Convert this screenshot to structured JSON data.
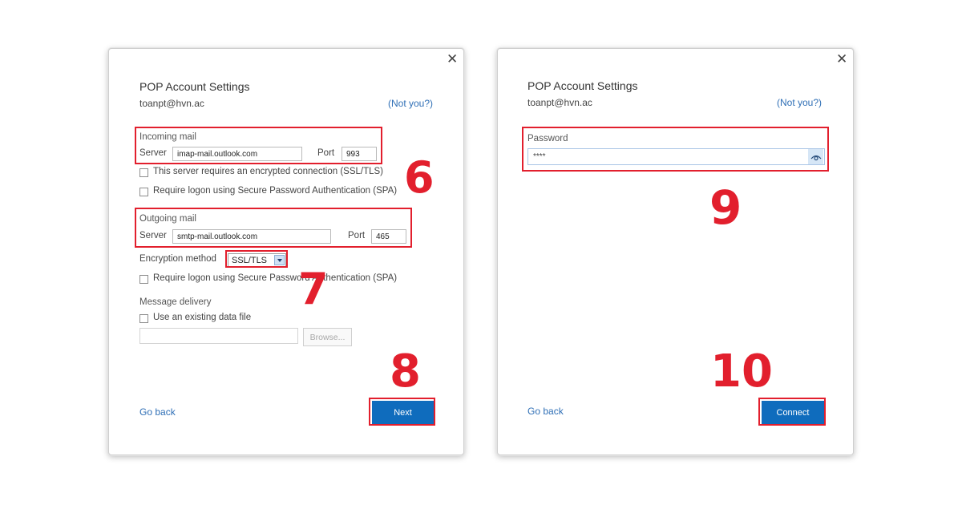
{
  "left_dialog": {
    "close_glyph": "✕",
    "title": "POP Account Settings",
    "email": "toanpt@hvn.ac",
    "not_you": "(Not you?)",
    "incoming": {
      "label": "Incoming mail",
      "server_label": "Server",
      "server_value": "imap-mail.outlook.com",
      "port_label": "Port",
      "port_value": "993"
    },
    "checkbox_ssl": "This server requires an encrypted connection (SSL/TLS)",
    "checkbox_spa_in": "Require logon using Secure Password Authentication (SPA)",
    "outgoing": {
      "label": "Outgoing mail",
      "server_label": "Server",
      "server_value": "smtp-mail.outlook.com",
      "port_label": "Port",
      "port_value": "465"
    },
    "encryption_label": "Encryption method",
    "encryption_value": "SSL/TLS",
    "checkbox_spa_out": "Require logon using Secure Password Authentication (SPA)",
    "message_delivery_label": "Message delivery",
    "checkbox_existing_file": "Use an existing data file",
    "data_file_value": "",
    "browse_label": "Browse...",
    "go_back": "Go back",
    "next_label": "Next"
  },
  "right_dialog": {
    "close_glyph": "✕",
    "title": "POP Account Settings",
    "email": "toanpt@hvn.ac",
    "not_you": "(Not you?)",
    "password_label": "Password",
    "password_value": "****",
    "go_back": "Go back",
    "connect_label": "Connect"
  },
  "annotations": {
    "step6": "6",
    "step7": "7",
    "step8": "8",
    "step9": "9",
    "step10": "10"
  },
  "colors": {
    "annotation_red": "#e21f2d",
    "primary_button": "#0f6cbd",
    "link": "#2f6fb6"
  },
  "icons": {
    "close": "close-icon",
    "dropdown": "chevron-down-icon",
    "show_password": "eye-icon"
  }
}
